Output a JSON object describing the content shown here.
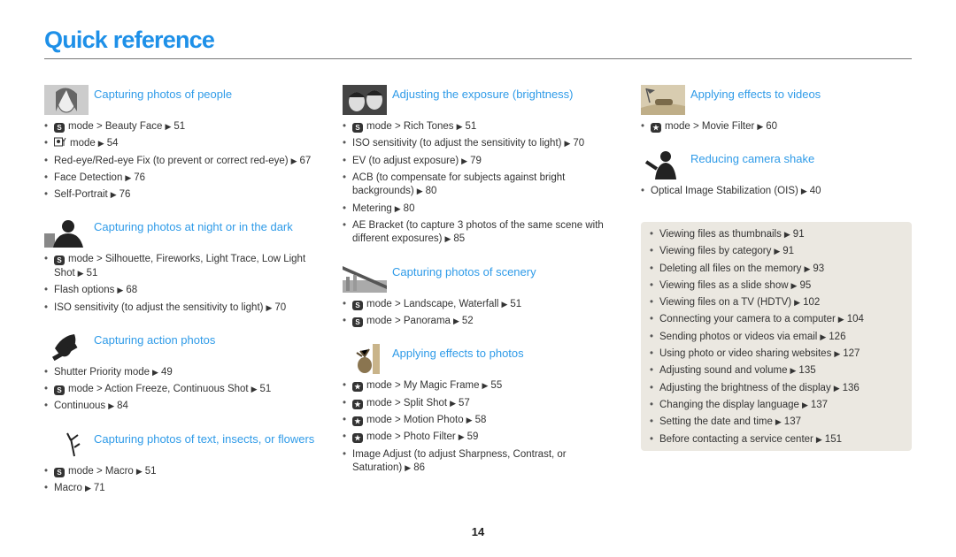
{
  "page": {
    "title": "Quick reference",
    "page_number": "14",
    "accent_color": "#2f9be8"
  },
  "columns": [
    {
      "sections": [
        {
          "title": "Capturing photos of people",
          "icon": "portrait-photo",
          "items": [
            {
              "mode_icon": "smart-mode",
              "text": "mode > Beauty Face",
              "page": "51"
            },
            {
              "mode_icon": "beauty-shot-mode",
              "text": "mode",
              "page": "54"
            },
            {
              "mode_icon": "",
              "text": "Red-eye/Red-eye Fix (to prevent or correct red-eye)",
              "page": "67"
            },
            {
              "mode_icon": "",
              "text": "Face Detection",
              "page": "76"
            },
            {
              "mode_icon": "",
              "text": "Self-Portrait",
              "page": "76"
            }
          ]
        },
        {
          "title": "Capturing photos at night or in the dark",
          "icon": "night-silhouette-photo",
          "items": [
            {
              "mode_icon": "smart-mode",
              "text": "mode > Silhouette, Fireworks, Light Trace, Low Light Shot",
              "page": "51"
            },
            {
              "mode_icon": "",
              "text": "Flash options",
              "page": "68"
            },
            {
              "mode_icon": "",
              "text": "ISO sensitivity (to adjust the sensitivity to light)",
              "page": "70"
            }
          ]
        },
        {
          "title": "Capturing action photos",
          "icon": "snowboarder-photo",
          "items": [
            {
              "mode_icon": "",
              "text": "Shutter Priority mode",
              "page": "49"
            },
            {
              "mode_icon": "smart-mode",
              "text": "mode > Action Freeze, Continuous Shot",
              "page": "51"
            },
            {
              "mode_icon": "",
              "text": "Continuous",
              "page": "84"
            }
          ]
        },
        {
          "title": "Capturing photos of text, insects, or flowers",
          "icon": "flower-photo",
          "items": [
            {
              "mode_icon": "smart-mode",
              "text": "mode > Macro",
              "page": "51"
            },
            {
              "mode_icon": "",
              "text": "Macro",
              "page": "71"
            }
          ]
        }
      ]
    },
    {
      "sections": [
        {
          "title": "Adjusting the exposure (brightness)",
          "icon": "couple-photo",
          "items": [
            {
              "mode_icon": "smart-mode",
              "text": "mode > Rich Tones",
              "page": "51"
            },
            {
              "mode_icon": "",
              "text": "ISO sensitivity (to adjust the sensitivity to light)",
              "page": "70"
            },
            {
              "mode_icon": "",
              "text": "EV (to adjust exposure)",
              "page": "79"
            },
            {
              "mode_icon": "",
              "text": "ACB (to compensate for subjects against bright backgrounds)",
              "page": "80"
            },
            {
              "mode_icon": "",
              "text": "Metering",
              "page": "80"
            },
            {
              "mode_icon": "",
              "text": "AE Bracket (to capture 3 photos of the same scene with different exposures)",
              "page": "85"
            }
          ]
        },
        {
          "title": "Capturing photos of scenery",
          "icon": "bridge-photo",
          "items": [
            {
              "mode_icon": "smart-mode",
              "text": "mode > Landscape, Waterfall",
              "page": "51"
            },
            {
              "mode_icon": "smart-mode",
              "text": "mode > Panorama",
              "page": "52"
            }
          ]
        },
        {
          "title": "Applying effects to photos",
          "icon": "vase-photo",
          "items": [
            {
              "mode_icon": "magic-plus-mode",
              "text": "mode > My Magic Frame",
              "page": "55"
            },
            {
              "mode_icon": "magic-plus-mode",
              "text": "mode > Split Shot",
              "page": "57"
            },
            {
              "mode_icon": "magic-plus-mode",
              "text": "mode > Motion Photo",
              "page": "58"
            },
            {
              "mode_icon": "magic-plus-mode",
              "text": "mode > Photo Filter",
              "page": "59"
            },
            {
              "mode_icon": "",
              "text": "Image Adjust (to adjust Sharpness, Contrast, or Saturation)",
              "page": "86"
            }
          ]
        }
      ]
    },
    {
      "sections": [
        {
          "title": "Applying effects to videos",
          "icon": "race-car-photo",
          "items": [
            {
              "mode_icon": "magic-plus-mode",
              "text": "mode > Movie Filter",
              "page": "60"
            }
          ]
        },
        {
          "title": "Reducing camera shake",
          "icon": "waving-person-photo",
          "items": [
            {
              "mode_icon": "",
              "text": "Optical Image Stabilization (OIS)",
              "page": "40"
            }
          ]
        }
      ]
    }
  ],
  "box": {
    "background": "#ebe8e1",
    "items": [
      {
        "text": "Viewing files as thumbnails",
        "page": "91"
      },
      {
        "text": "Viewing files by category",
        "page": "91"
      },
      {
        "text": "Deleting all files on the memory",
        "page": "93"
      },
      {
        "text": "Viewing files as a slide show",
        "page": "95"
      },
      {
        "text": "Viewing files on a TV (HDTV)",
        "page": "102"
      },
      {
        "text": "Connecting your camera to a computer",
        "page": "104"
      },
      {
        "text": "Sending photos or videos via email",
        "page": "126"
      },
      {
        "text": "Using photo or video sharing websites",
        "page": "127"
      },
      {
        "text": "Adjusting sound and volume",
        "page": "135"
      },
      {
        "text": "Adjusting the brightness of the display",
        "page": "136"
      },
      {
        "text": "Changing the display language",
        "page": "137"
      },
      {
        "text": "Setting the date and time",
        "page": "137"
      },
      {
        "text": "Before contacting a service center",
        "page": "151"
      }
    ]
  }
}
